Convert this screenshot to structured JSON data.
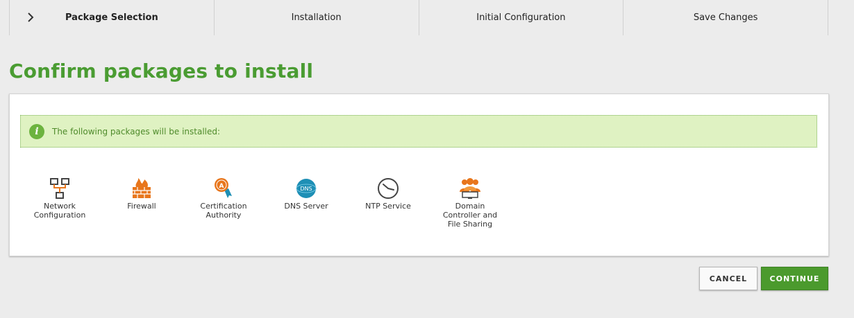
{
  "wizard": {
    "steps": [
      {
        "label": "Package Selection",
        "active": true
      },
      {
        "label": "Installation",
        "active": false
      },
      {
        "label": "Initial Configuration",
        "active": false
      },
      {
        "label": "Save Changes",
        "active": false
      }
    ],
    "current_step_icon": "chevron-right-icon"
  },
  "page": {
    "title": "Confirm packages to install"
  },
  "notice": {
    "icon": "info-icon",
    "message": "The following packages will be installed:"
  },
  "packages": [
    {
      "icon": "network-icon",
      "label": "Network Configuration"
    },
    {
      "icon": "firewall-icon",
      "label": "Firewall"
    },
    {
      "icon": "certificate-icon",
      "label": "Certification Authority"
    },
    {
      "icon": "dns-icon",
      "icon_text": "DNS",
      "label": "DNS Server"
    },
    {
      "icon": "clock-icon",
      "label": "NTP Service"
    },
    {
      "icon": "users-icon",
      "label": "Domain Controller and File Sharing"
    }
  ],
  "actions": {
    "cancel_label": "CANCEL",
    "continue_label": "CONTINUE"
  },
  "colors": {
    "accent_green": "#4a9c32",
    "button_green": "#4b9a2d",
    "notice_bg": "#dff2c2",
    "icon_orange": "#e8761c",
    "dns_blue": "#1e8fb5"
  }
}
